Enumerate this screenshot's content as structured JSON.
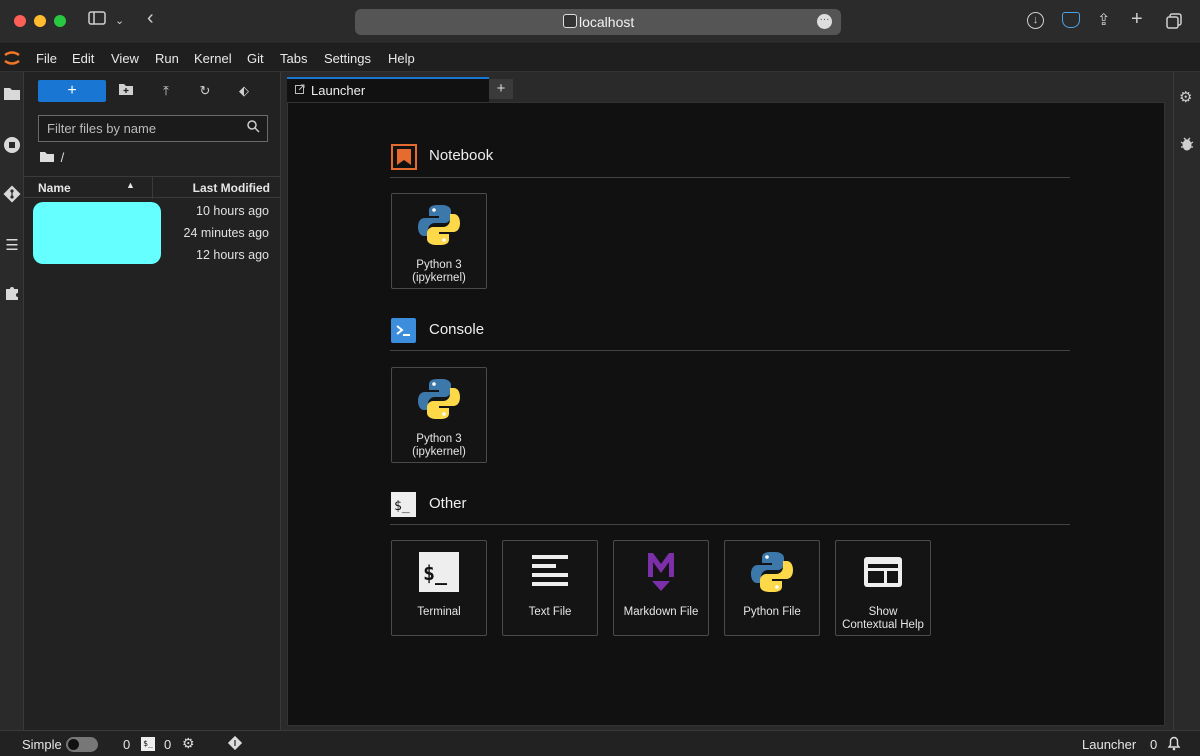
{
  "browser": {
    "url": "localhost"
  },
  "menu": [
    "File",
    "Edit",
    "View",
    "Run",
    "Kernel",
    "Git",
    "Tabs",
    "Settings",
    "Help"
  ],
  "filebrowser": {
    "new_label": "+",
    "filter_placeholder": "Filter files by name",
    "breadcrumb": "/",
    "col_name": "Name",
    "col_modified": "Last Modified",
    "rows": [
      {
        "modified": "10 hours ago"
      },
      {
        "modified": "24 minutes ago"
      },
      {
        "modified": "12 hours ago"
      }
    ]
  },
  "tabs": {
    "launcher_label": "Launcher",
    "add": "+"
  },
  "launcher": {
    "notebook": {
      "title": "Notebook",
      "cards": [
        {
          "label": "Python 3\n(ipykernel)"
        }
      ]
    },
    "console": {
      "title": "Console",
      "cards": [
        {
          "label": "Python 3\n(ipykernel)"
        }
      ]
    },
    "other": {
      "title": "Other",
      "cards": [
        {
          "label": "Terminal"
        },
        {
          "label": "Text File"
        },
        {
          "label": "Markdown File"
        },
        {
          "label": "Python File"
        },
        {
          "label": "Show\nContextual Help"
        }
      ]
    }
  },
  "status": {
    "mode": "Simple",
    "terminals": "0",
    "kernels": "0",
    "right_label": "Launcher",
    "notifications": "0"
  },
  "colors": {
    "accent": "#1976d2",
    "notebook": "#e66b2e",
    "console": "#3c8ddc",
    "markdown": "#7b2fa8"
  }
}
